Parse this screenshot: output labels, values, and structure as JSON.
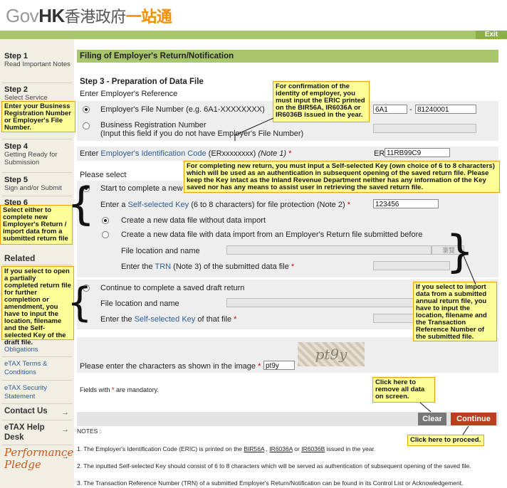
{
  "header": {
    "logo_gov": "Gov",
    "logo_hk": "HK",
    "logo_cn1": "香港政府",
    "logo_cn2": "一站通",
    "exit_label": "Exit"
  },
  "sidebar": {
    "steps": [
      {
        "num": "Step 1",
        "label": "Read Important Notes"
      },
      {
        "num": "Step 2",
        "label": "Select Service"
      },
      {
        "num": "Step 4",
        "label": "Getting Ready for Submission"
      },
      {
        "num": "Step 5",
        "label": "Sign and/or Submit"
      },
      {
        "num": "Step 6",
        "label": ""
      }
    ],
    "related": "Related",
    "links": [
      "Obligations",
      "eTAX Terms & Conditions",
      "eTAX Security Statement"
    ],
    "contact": "Contact Us",
    "help": "eTAX Help Desk",
    "pledge": "Performance Pledge"
  },
  "page_title": "Filing of Employer's Return/Notification",
  "step_title": "Step 3 - Preparation of Data File",
  "ref_label": "Enter Employer's Reference",
  "file_number_label": "Employer's File Number (e.g. 6A1-XXXXXXXX)",
  "br_label": "Business Registration Number",
  "br_sub": "(Input this field if you do not have Employer's File Number)",
  "file_prefix": "6A1",
  "file_number": "81240001",
  "eric_label_pre": "Enter ",
  "eric_link": "Employer's Identification Code",
  "eric_label_post": " (ERxxxxxxxx) ",
  "eric_note": "(Note 1)",
  "eric_prefix": "ER",
  "eric_value": "11RB99C9",
  "please_select": "Please select",
  "start_new_label": "Start to complete a new",
  "key_pre": "Enter a ",
  "key_link": "Self-selected Key",
  "key_post": " (6 to 8 characters) for file protection (Note 2) ",
  "key_value": "123456",
  "opt_without": "Create a new data file without data import",
  "opt_with": "Create a new data file with data import from an Employer's Return file submitted before",
  "file_loc": "File location and name",
  "browse_label": "瀏覽",
  "trn_pre": "Enter the ",
  "trn_link": "TRN",
  "trn_post": " (Note 3) of the submitted data file ",
  "continue_draft": "Continue to complete a saved draft return",
  "file_loc2": "File location and name",
  "self_key_pre": "Enter the ",
  "self_key_link": "Self-selected Key",
  "self_key_post": " of that file ",
  "captcha_label": "Please enter the characters as shown in the image ",
  "captcha_image_text": "pt9y",
  "captcha_value": "pt9y",
  "mandatory_pre": "Fields with ",
  "mandatory_post": " are mandatory.",
  "star": "*",
  "clear_label": "Clear",
  "continue_label": "Continue",
  "notes_title": "NOTES :",
  "note1": {
    "pre": "1. The Employer's Identification Code (ERIC) is printed on the ",
    "l1": "BIR56A",
    "s1": " , ",
    "l2": "IR6036A",
    "s2": " or ",
    "l3": "IR6036B",
    "post": " issued in the year."
  },
  "note2": "2. The inputted Self-selected Key should consist of 6 to 8 characters which will be served as authentication of subsequent opening of the saved file.",
  "note3": "3. The Transaction Reference Number (TRN) of a submitted Employer's Return/Notification can be found in its Control List or Acknowledgement.",
  "callouts": {
    "business": "Enter your Business Registration Number or Employer's File Number.",
    "eric_confirm": "For confirmation of the identity of employer, you must input the ERIC printed on the BIR56A, IR6036A or IR6036B issued in the year.",
    "self_key": "For completing new return, you must input a Self-selected Key (own choice of 6 to 8 characters) which will be used as an authentication in subsequent opening of the saved return file. Please keep the Key intact as the Inland Revenue Department neither has any information of the Key saved nor has any means to assist user in retrieving the saved return file.",
    "select_either": "Select either to complete new Employer's Return / import data from a submitted return file",
    "draft": "If you select to open a partially completed return file for further completion or amendment, you have to input the location, filename and the Self-selected Key of the draft file.",
    "import": "If you select to import data from a submitted annual return file, you have to input the location, filename and the Transaction Reference Number of the submitted file.",
    "clear": "Click here to remove all data on screen.",
    "proceed": "Click here to proceed."
  },
  "colors": {
    "green_bar": "#a8c66c",
    "callout_bg": "#ffff99",
    "clear_btn": "#777777",
    "continue_btn": "#b8401e"
  }
}
